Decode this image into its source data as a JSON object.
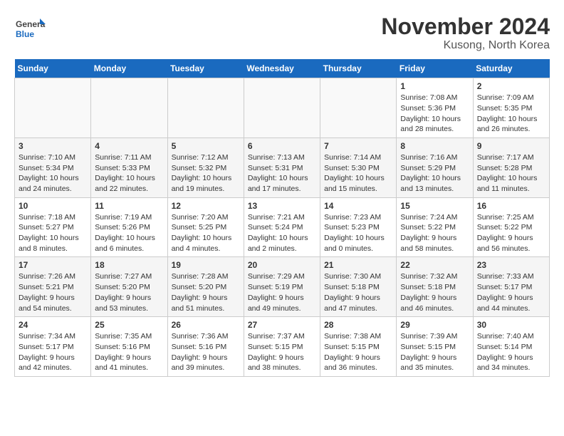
{
  "header": {
    "logo_general": "General",
    "logo_blue": "Blue",
    "month_title": "November 2024",
    "location": "Kusong, North Korea"
  },
  "weekdays": [
    "Sunday",
    "Monday",
    "Tuesday",
    "Wednesday",
    "Thursday",
    "Friday",
    "Saturday"
  ],
  "weeks": [
    [
      {
        "day": "",
        "info": ""
      },
      {
        "day": "",
        "info": ""
      },
      {
        "day": "",
        "info": ""
      },
      {
        "day": "",
        "info": ""
      },
      {
        "day": "",
        "info": ""
      },
      {
        "day": "1",
        "info": "Sunrise: 7:08 AM\nSunset: 5:36 PM\nDaylight: 10 hours\nand 28 minutes."
      },
      {
        "day": "2",
        "info": "Sunrise: 7:09 AM\nSunset: 5:35 PM\nDaylight: 10 hours\nand 26 minutes."
      }
    ],
    [
      {
        "day": "3",
        "info": "Sunrise: 7:10 AM\nSunset: 5:34 PM\nDaylight: 10 hours\nand 24 minutes."
      },
      {
        "day": "4",
        "info": "Sunrise: 7:11 AM\nSunset: 5:33 PM\nDaylight: 10 hours\nand 22 minutes."
      },
      {
        "day": "5",
        "info": "Sunrise: 7:12 AM\nSunset: 5:32 PM\nDaylight: 10 hours\nand 19 minutes."
      },
      {
        "day": "6",
        "info": "Sunrise: 7:13 AM\nSunset: 5:31 PM\nDaylight: 10 hours\nand 17 minutes."
      },
      {
        "day": "7",
        "info": "Sunrise: 7:14 AM\nSunset: 5:30 PM\nDaylight: 10 hours\nand 15 minutes."
      },
      {
        "day": "8",
        "info": "Sunrise: 7:16 AM\nSunset: 5:29 PM\nDaylight: 10 hours\nand 13 minutes."
      },
      {
        "day": "9",
        "info": "Sunrise: 7:17 AM\nSunset: 5:28 PM\nDaylight: 10 hours\nand 11 minutes."
      }
    ],
    [
      {
        "day": "10",
        "info": "Sunrise: 7:18 AM\nSunset: 5:27 PM\nDaylight: 10 hours\nand 8 minutes."
      },
      {
        "day": "11",
        "info": "Sunrise: 7:19 AM\nSunset: 5:26 PM\nDaylight: 10 hours\nand 6 minutes."
      },
      {
        "day": "12",
        "info": "Sunrise: 7:20 AM\nSunset: 5:25 PM\nDaylight: 10 hours\nand 4 minutes."
      },
      {
        "day": "13",
        "info": "Sunrise: 7:21 AM\nSunset: 5:24 PM\nDaylight: 10 hours\nand 2 minutes."
      },
      {
        "day": "14",
        "info": "Sunrise: 7:23 AM\nSunset: 5:23 PM\nDaylight: 10 hours\nand 0 minutes."
      },
      {
        "day": "15",
        "info": "Sunrise: 7:24 AM\nSunset: 5:22 PM\nDaylight: 9 hours\nand 58 minutes."
      },
      {
        "day": "16",
        "info": "Sunrise: 7:25 AM\nSunset: 5:22 PM\nDaylight: 9 hours\nand 56 minutes."
      }
    ],
    [
      {
        "day": "17",
        "info": "Sunrise: 7:26 AM\nSunset: 5:21 PM\nDaylight: 9 hours\nand 54 minutes."
      },
      {
        "day": "18",
        "info": "Sunrise: 7:27 AM\nSunset: 5:20 PM\nDaylight: 9 hours\nand 53 minutes."
      },
      {
        "day": "19",
        "info": "Sunrise: 7:28 AM\nSunset: 5:20 PM\nDaylight: 9 hours\nand 51 minutes."
      },
      {
        "day": "20",
        "info": "Sunrise: 7:29 AM\nSunset: 5:19 PM\nDaylight: 9 hours\nand 49 minutes."
      },
      {
        "day": "21",
        "info": "Sunrise: 7:30 AM\nSunset: 5:18 PM\nDaylight: 9 hours\nand 47 minutes."
      },
      {
        "day": "22",
        "info": "Sunrise: 7:32 AM\nSunset: 5:18 PM\nDaylight: 9 hours\nand 46 minutes."
      },
      {
        "day": "23",
        "info": "Sunrise: 7:33 AM\nSunset: 5:17 PM\nDaylight: 9 hours\nand 44 minutes."
      }
    ],
    [
      {
        "day": "24",
        "info": "Sunrise: 7:34 AM\nSunset: 5:17 PM\nDaylight: 9 hours\nand 42 minutes."
      },
      {
        "day": "25",
        "info": "Sunrise: 7:35 AM\nSunset: 5:16 PM\nDaylight: 9 hours\nand 41 minutes."
      },
      {
        "day": "26",
        "info": "Sunrise: 7:36 AM\nSunset: 5:16 PM\nDaylight: 9 hours\nand 39 minutes."
      },
      {
        "day": "27",
        "info": "Sunrise: 7:37 AM\nSunset: 5:15 PM\nDaylight: 9 hours\nand 38 minutes."
      },
      {
        "day": "28",
        "info": "Sunrise: 7:38 AM\nSunset: 5:15 PM\nDaylight: 9 hours\nand 36 minutes."
      },
      {
        "day": "29",
        "info": "Sunrise: 7:39 AM\nSunset: 5:15 PM\nDaylight: 9 hours\nand 35 minutes."
      },
      {
        "day": "30",
        "info": "Sunrise: 7:40 AM\nSunset: 5:14 PM\nDaylight: 9 hours\nand 34 minutes."
      }
    ]
  ]
}
